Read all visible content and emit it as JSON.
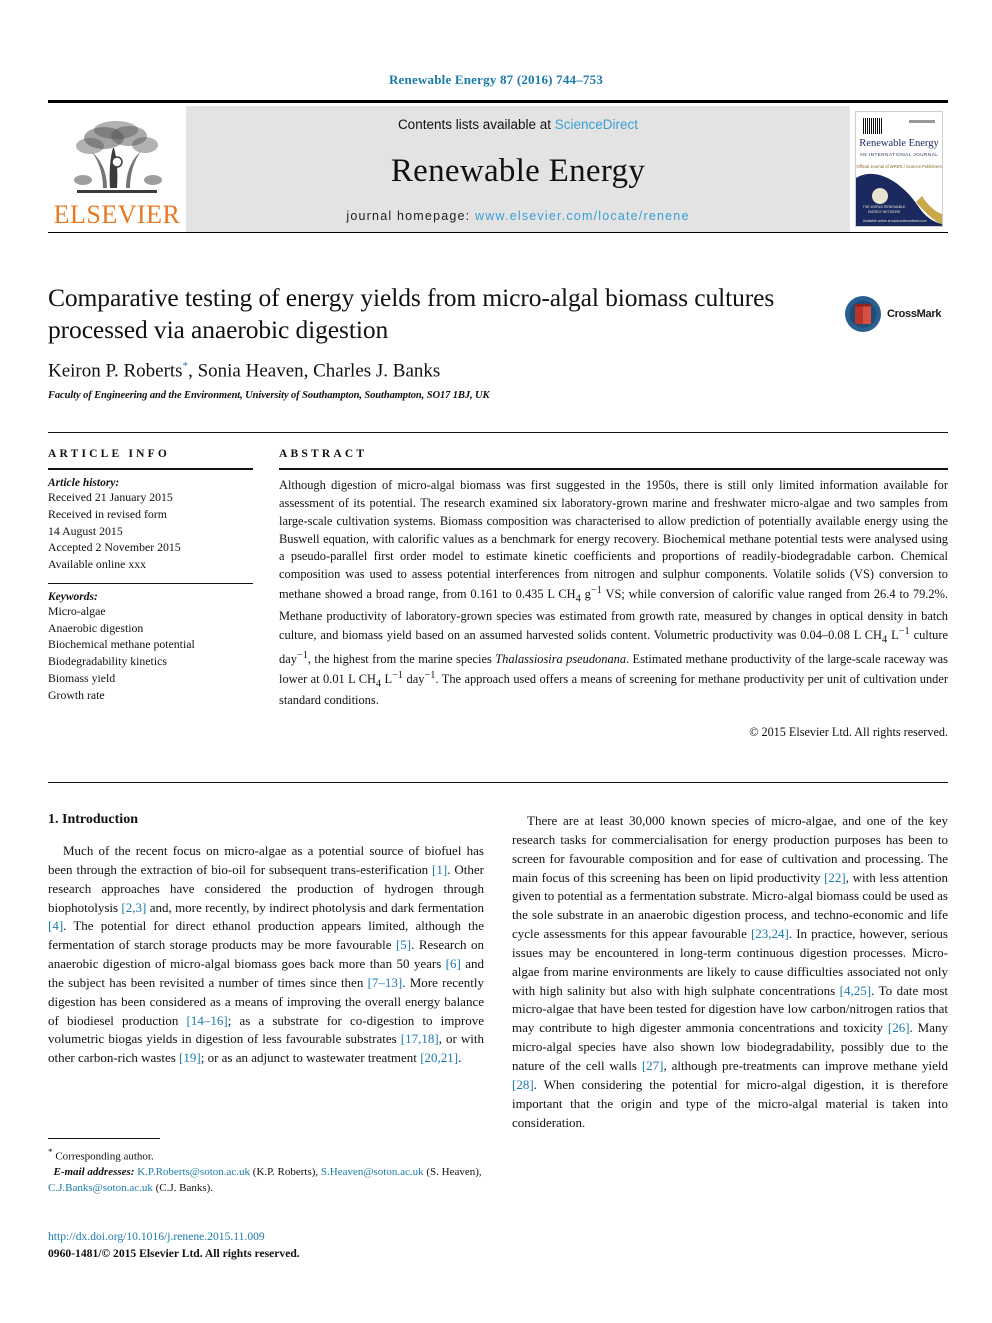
{
  "running_head": "Renewable Energy 87 (2016) 744–753",
  "masthead": {
    "publisher_name": "ELSEVIER",
    "contents_prefix": "Contents lists available at ",
    "contents_link": "ScienceDirect",
    "journal_title": "Renewable Energy",
    "homepage_prefix": "journal homepage: ",
    "homepage_url": "www.elsevier.com/locate/renene",
    "cover": {
      "title": "Renewable Energy",
      "subtitle": "AN INTERNATIONAL JOURNAL",
      "tagline": "Official Journal of WREN / Science Publishers",
      "emblem_text": "THE WORLD RENEWABLE ENERGY NETWORK",
      "footer": "Available online at www.sciencedirect.com"
    }
  },
  "article": {
    "title": "Comparative testing of energy yields from micro-algal biomass cultures processed via anaerobic digestion",
    "authors": "Keiron P. Roberts",
    "authors_rest": ", Sonia Heaven, Charles J. Banks",
    "corresponding_marker": "*",
    "affiliation": "Faculty of Engineering and the Environment, University of Southampton, Southampton, SO17 1BJ, UK",
    "crossmark_label": "CrossMark"
  },
  "article_info": {
    "heading": "ARTICLE INFO",
    "history_label": "Article history:",
    "history": [
      "Received 21 January 2015",
      "Received in revised form",
      "14 August 2015",
      "Accepted 2 November 2015",
      "Available online xxx"
    ],
    "keywords_label": "Keywords:",
    "keywords": [
      "Micro-algae",
      "Anaerobic digestion",
      "Biochemical methane potential",
      "Biodegradability kinetics",
      "Biomass yield",
      "Growth rate"
    ]
  },
  "abstract": {
    "heading": "ABSTRACT",
    "part1": "Although digestion of micro-algal biomass was first suggested in the 1950s, there is still only limited information available for assessment of its potential. The research examined six laboratory-grown marine and freshwater micro-algae and two samples from large-scale cultivation systems. Biomass composition was characterised to allow prediction of potentially available energy using the Buswell equation, with calorific values as a benchmark for energy recovery. Biochemical methane potential tests were analysed using a pseudo-parallel first order model to estimate kinetic coefficients and proportions of readily-biodegradable carbon. Chemical composition was used to assess potential interferences from nitrogen and sulphur components. Volatile solids (VS) conversion to methane showed a broad range, from 0.161 to 0.435 L CH",
    "part2": " VS; while conversion of calorific value ranged from 26.4 to 79.2%. Methane productivity of laboratory-grown species was estimated from growth rate, measured by changes in optical density in batch culture, and biomass yield based on an assumed harvested solids content. Volumetric productivity was 0.04–0.08 L CH",
    "part3": " culture day",
    "part4": ", the highest from the marine species ",
    "species": "Thalassiosira pseudonana",
    "part5": ". Estimated methane productivity of the large-scale raceway was lower at 0.01 L CH",
    "part6": " day",
    "part7": ". The approach used offers a means of screening for methane productivity per unit of cultivation under standard conditions.",
    "copyright": "© 2015 Elsevier Ltd. All rights reserved."
  },
  "introduction": {
    "heading": "1. Introduction",
    "left_p1_a": "Much of the recent focus on micro-algae as a potential source of biofuel has been through the extraction of bio-oil for subsequent trans-esterification ",
    "left_r1": "[1]",
    "left_p1_b": ". Other research approaches have considered the production of hydrogen through biophotolysis ",
    "left_r2": "[2,3]",
    "left_p1_c": " and, more recently, by indirect photolysis and dark fermentation ",
    "left_r3": "[4]",
    "left_p1_d": ". The potential for direct ethanol production appears limited, although the fermentation of starch storage products may be more favourable ",
    "left_r4": "[5]",
    "left_p1_e": ". Research on anaerobic digestion of micro-algal biomass goes back more than 50 years ",
    "left_r5": "[6]",
    "left_p1_f": " and the subject has been revisited a number of times since then ",
    "left_r6": "[7–13]",
    "left_p1_g": ". More recently digestion has been considered as a means of improving the overall energy balance of biodiesel production ",
    "left_r7": "[14–16]",
    "left_p1_h": "; as a substrate for co-digestion to improve volumetric biogas yields in digestion of less favourable substrates ",
    "left_r8": "[17,18]",
    "left_p1_i": ", or with other carbon-rich wastes ",
    "left_r9": "[19]",
    "left_p1_j": "; or as an adjunct to wastewater treatment ",
    "left_r10": "[20,21]",
    "left_p1_k": ".",
    "right_p1_a": "There are at least 30,000 known species of micro-algae, and one of the key research tasks for commercialisation for energy production purposes has been to screen for favourable composition and for ease of cultivation and processing. The main focus of this screening has been on lipid productivity ",
    "right_r1": "[22]",
    "right_p1_b": ", with less attention given to potential as a fermentation substrate. Micro-algal biomass could be used as the sole substrate in an anaerobic digestion process, and techno-economic and life cycle assessments for this appear favourable ",
    "right_r2": "[23,24]",
    "right_p1_c": ". In practice, however, serious issues may be encountered in long-term continuous digestion processes. Micro-algae from marine environments are likely to cause difficulties associated not only with high salinity but also with high sulphate concentrations ",
    "right_r3": "[4,25]",
    "right_p1_d": ". To date most micro-algae that have been tested for digestion have low carbon/nitrogen ratios that may contribute to high digester ammonia concentrations and toxicity ",
    "right_r4": "[26]",
    "right_p1_e": ". Many micro-algal species have also shown low biodegradability, possibly due to the nature of the cell walls ",
    "right_r5": "[27]",
    "right_p1_f": ", although pre-treatments can improve methane yield ",
    "right_r6": "[28]",
    "right_p1_g": ". When considering the potential for micro-algal digestion, it is therefore important that the origin and type of the micro-algal material is taken into consideration."
  },
  "footnotes": {
    "corresponding_marker": "*",
    "corresponding": "Corresponding author.",
    "email_label": "E-mail addresses:",
    "email1": "K.P.Roberts@soton.ac.uk",
    "email1_name": " (K.P. Roberts), ",
    "email2": "S.Heaven@soton.ac.uk",
    "email2_name": " (S. Heaven), ",
    "email3": "C.J.Banks@soton.ac.uk",
    "email3_name": " (C.J. Banks)."
  },
  "doi": {
    "url": "http://dx.doi.org/10.1016/j.renene.2015.11.009",
    "issn_line": "0960-1481/© 2015 Elsevier Ltd. All rights reserved."
  },
  "colors": {
    "link": "#1a7bab",
    "sciencedirect": "#3a9fd4",
    "elsevier_orange": "#E87722",
    "masthead_bg": "#e3e3e3"
  }
}
